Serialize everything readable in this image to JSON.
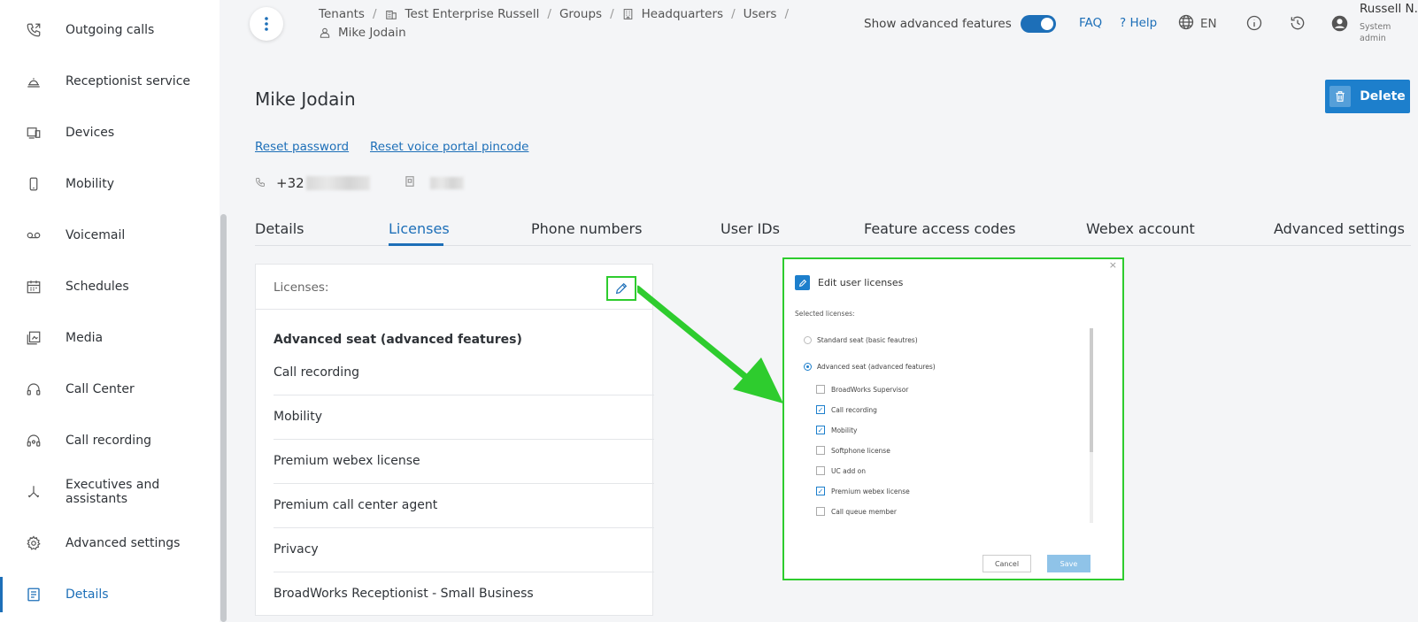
{
  "sidebar": {
    "items": [
      {
        "label": "Outgoing calls",
        "icon": "outgoing-call-icon"
      },
      {
        "label": "Receptionist service",
        "icon": "reception-bell-icon"
      },
      {
        "label": "Devices",
        "icon": "devices-icon"
      },
      {
        "label": "Mobility",
        "icon": "mobile-phone-icon"
      },
      {
        "label": "Voicemail",
        "icon": "voicemail-icon"
      },
      {
        "label": "Schedules",
        "icon": "calendar-icon"
      },
      {
        "label": "Media",
        "icon": "media-icon"
      },
      {
        "label": "Call Center",
        "icon": "headset-icon"
      },
      {
        "label": "Call recording",
        "icon": "recording-headset-icon"
      },
      {
        "label": "Executives and assistants",
        "icon": "executives-icon"
      },
      {
        "label": "Advanced settings",
        "icon": "gear-icon"
      },
      {
        "label": "Details",
        "icon": "details-document-icon",
        "active": true
      }
    ]
  },
  "breadcrumb": {
    "tenants": "Tenants",
    "enterprise": "Test Enterprise Russell",
    "groups": "Groups",
    "group": "Headquarters",
    "users": "Users",
    "user": "Mike Jodain",
    "separator": "/"
  },
  "header": {
    "advanced_features_label": "Show advanced features",
    "advanced_features_on": true,
    "faq": "FAQ",
    "help": "? Help",
    "language": "EN",
    "user_name": "Russell N.",
    "user_role": "System admin"
  },
  "page": {
    "title": "Mike Jodain",
    "delete_label": "Delete",
    "reset_password": "Reset password",
    "reset_pincode": "Reset voice portal pincode",
    "phone_prefix": "+32"
  },
  "tabs": [
    {
      "label": "Details"
    },
    {
      "label": "Licenses",
      "active": true
    },
    {
      "label": "Phone numbers"
    },
    {
      "label": "User IDs"
    },
    {
      "label": "Feature access codes"
    },
    {
      "label": "Webex account"
    },
    {
      "label": "Advanced settings"
    }
  ],
  "licenses_card": {
    "header": "Licenses:",
    "title": "Advanced seat (advanced features)",
    "items": [
      "Call recording",
      "Mobility",
      "Premium webex license",
      "Premium call center agent",
      "Privacy",
      "BroadWorks Receptionist - Small Business"
    ]
  },
  "dialog": {
    "title": "Edit user licenses",
    "close": "×",
    "subtitle": "Selected licenses:",
    "radios": [
      {
        "label": "Standard seat (basic feautres)",
        "selected": false
      },
      {
        "label": "Advanced seat (advanced features)",
        "selected": true
      }
    ],
    "checkboxes": [
      {
        "label": "BroadWorks Supervisor",
        "checked": false
      },
      {
        "label": "Call recording",
        "checked": true
      },
      {
        "label": "Mobility",
        "checked": true
      },
      {
        "label": "Softphone license",
        "checked": false
      },
      {
        "label": "UC add on",
        "checked": false
      },
      {
        "label": "Premium webex license",
        "checked": true
      },
      {
        "label": "Call queue member",
        "checked": false
      }
    ],
    "cancel": "Cancel",
    "save": "Save"
  },
  "colors": {
    "accent": "#1d6fb8",
    "highlight": "#2ecc2e"
  }
}
